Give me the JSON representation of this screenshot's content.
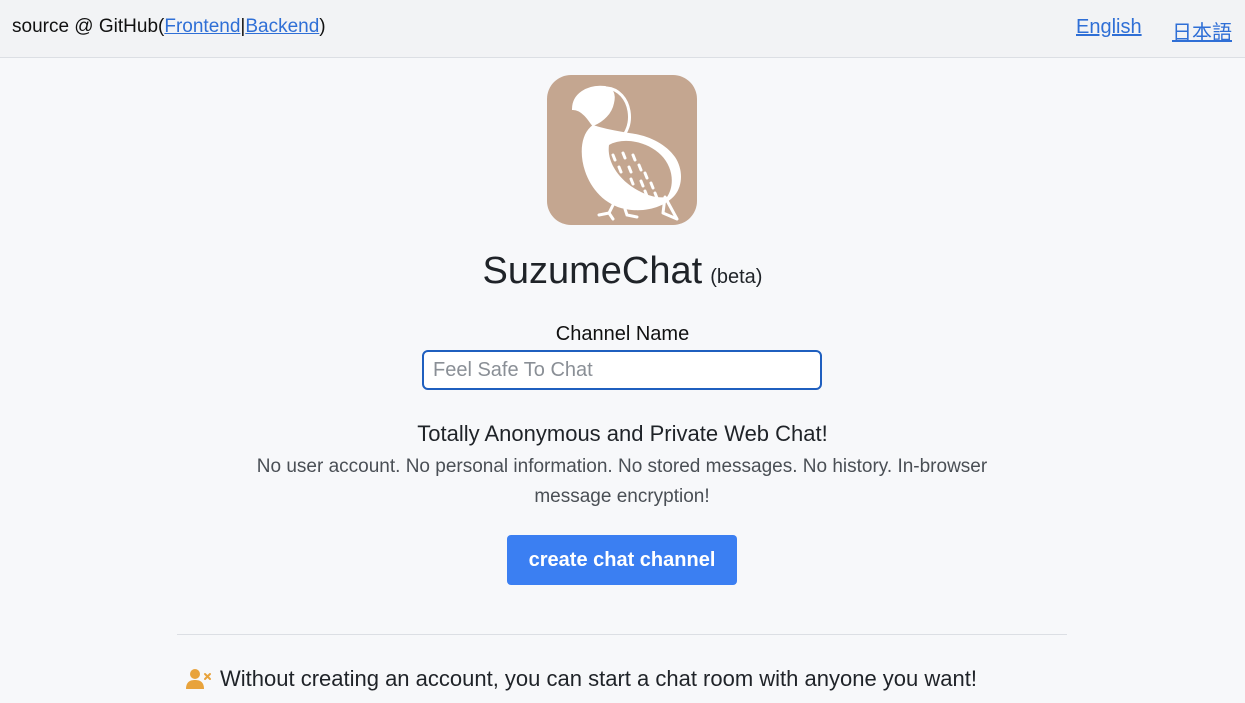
{
  "topbar": {
    "source_prefix": "source @ GitHub(",
    "frontend_link": "Frontend",
    "separator": "|",
    "backend_link": "Backend",
    "source_suffix": ")",
    "lang_english": "English",
    "lang_japanese": "日本語"
  },
  "branding": {
    "logo_icon": "sparrow-icon",
    "logo_bg_color": "#c4a690",
    "app_name": "SuzumeChat",
    "beta_tag": "(beta)"
  },
  "form": {
    "channel_label": "Channel Name",
    "channel_placeholder": "Feel Safe To Chat",
    "channel_value": ""
  },
  "intro": {
    "headline": "Totally Anonymous and Private Web Chat!",
    "description": "No user account. No personal information. No stored messages. No history. In-browser message encryption!"
  },
  "actions": {
    "create_label": "create chat channel",
    "accent_color": "#3b7ff2"
  },
  "features": [
    {
      "icon": "user-x-icon",
      "text": "Without creating an account, you can start a chat room with anyone you want!"
    }
  ]
}
